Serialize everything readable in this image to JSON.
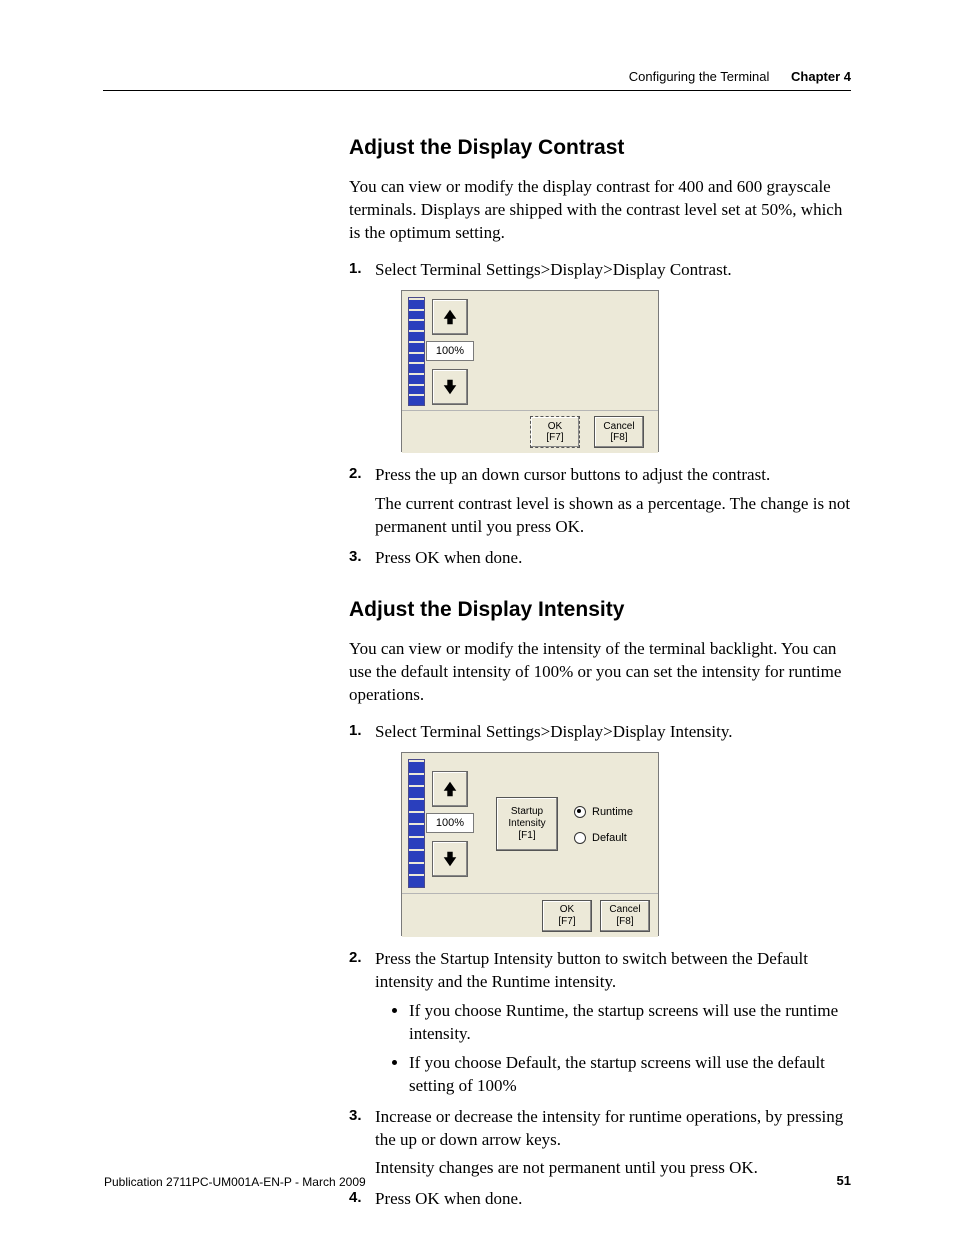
{
  "header": {
    "section": "Configuring the Terminal",
    "chapter": "Chapter 4"
  },
  "contrast": {
    "heading": "Adjust the Display Contrast",
    "intro": "You can view or modify the display contrast for 400 and 600 grayscale terminals. Displays are shipped with the contrast level set at 50%, which is the optimum setting.",
    "step1": "Select Terminal Settings>Display>Display Contrast.",
    "dialog": {
      "value": "100%",
      "ok_label": "OK",
      "ok_key": "[F7]",
      "cancel_label": "Cancel",
      "cancel_key": "[F8]"
    },
    "step2": "Press the up an down cursor buttons to adjust the contrast.",
    "step2_follow": "The current contrast level is shown as a percentage. The change is not permanent until you press OK.",
    "step3": "Press OK when done."
  },
  "intensity": {
    "heading": "Adjust the Display Intensity",
    "intro": "You can view or modify the intensity of the terminal backlight. You can use the default intensity of 100% or you can set the intensity for runtime operations.",
    "step1": "Select Terminal Settings>Display>Display Intensity.",
    "dialog": {
      "value": "100%",
      "startup_l1": "Startup",
      "startup_l2": "Intensity",
      "startup_key": "[F1]",
      "radio_runtime": "Runtime",
      "radio_default": "Default",
      "radio_selected": "runtime",
      "ok_label": "OK",
      "ok_key": "[F7]",
      "cancel_label": "Cancel",
      "cancel_key": "[F8]"
    },
    "step2": "Press the Startup Intensity button to switch between the Default intensity and the Runtime intensity.",
    "bullet1": "If you choose Runtime, the startup screens will use the runtime intensity.",
    "bullet2": "If you choose Default, the startup screens will use the default setting of 100%",
    "step3": "Increase or decrease the intensity for runtime operations, by pressing the up or down arrow keys.",
    "step3_follow": "Intensity changes are not permanent until you press OK.",
    "step4": "Press OK when done."
  },
  "footer": {
    "publication": "Publication 2711PC-UM001A-EN-P - March 2009",
    "page": "51"
  }
}
